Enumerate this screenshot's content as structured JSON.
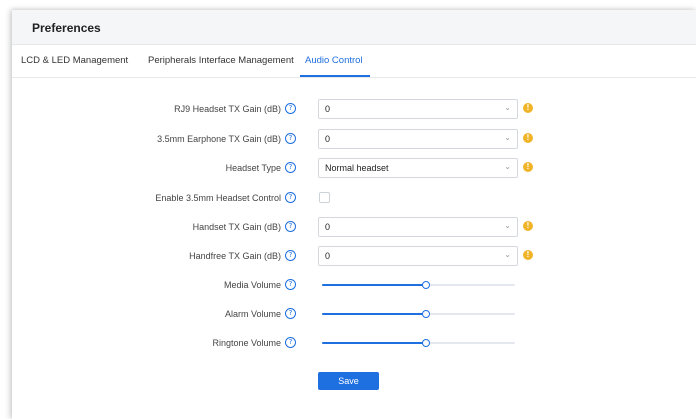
{
  "header": {
    "title": "Preferences"
  },
  "tabs": [
    {
      "label": "LCD & LED Management"
    },
    {
      "label": "Peripherals Interface Management"
    },
    {
      "label": "Audio Control"
    }
  ],
  "form": {
    "rj9_tx_gain": {
      "label": "RJ9 Headset TX Gain (dB)",
      "value": "0"
    },
    "earphone_tx_gain": {
      "label": "3.5mm Earphone TX Gain (dB)",
      "value": "0"
    },
    "headset_type": {
      "label": "Headset Type",
      "value": "Normal headset"
    },
    "headset_control": {
      "label": "Enable 3.5mm Headset Control",
      "checked": false
    },
    "handset_tx_gain": {
      "label": "Handset TX Gain (dB)",
      "value": "0"
    },
    "handfree_tx_gain": {
      "label": "Handfree TX Gain (dB)",
      "value": "0"
    },
    "media_volume": {
      "label": "Media Volume",
      "level": 0.54
    },
    "alarm_volume": {
      "label": "Alarm Volume",
      "level": 0.54
    },
    "ringtone_volume": {
      "label": "Ringtone Volume",
      "level": 0.54
    }
  },
  "actions": {
    "save_label": "Save"
  },
  "icons": {
    "help": "question-circle-icon",
    "warning": "exclamation-circle-icon",
    "chevron": "chevron-down-icon"
  },
  "colors": {
    "accent": "#1e6fe0",
    "warning": "#f0b429"
  }
}
